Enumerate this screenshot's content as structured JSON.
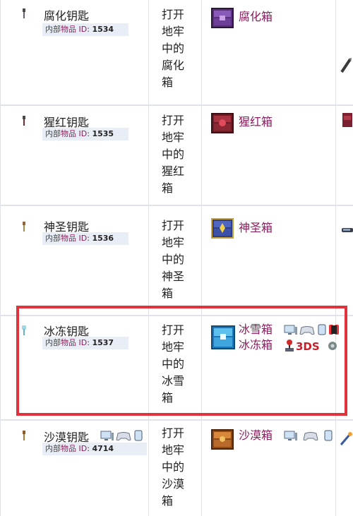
{
  "rows": [
    {
      "key_name": "腐化钥匙",
      "id_prefix": "内部",
      "id_item": "物品",
      "id_suffix": " ID",
      "id_colon": ":",
      "id_value": "1534",
      "description": "打开地牢中的腐化箱",
      "chest": "腐化箱",
      "chest_color": "#7a4aa0"
    },
    {
      "key_name": "猩红钥匙",
      "id_prefix": "内部",
      "id_item": "物品",
      "id_suffix": " ID",
      "id_colon": ":",
      "id_value": "1535",
      "description": "打开地牢中的猩红箱",
      "chest": "猩红箱",
      "chest_color": "#9a2a36"
    },
    {
      "key_name": "神圣钥匙",
      "id_prefix": "内部",
      "id_item": "物品",
      "id_suffix": " ID",
      "id_colon": ":",
      "id_value": "1536",
      "description": "打开地牢中的神圣箱",
      "chest": "神圣箱",
      "chest_color": "#3a4f9a"
    },
    {
      "key_name": "冰冻钥匙",
      "id_prefix": "内部",
      "id_item": "物品",
      "id_suffix": " ID",
      "id_colon": ":",
      "id_value": "1537",
      "description": "打开地牢中的冰雪箱",
      "chest": "冰雪箱",
      "chest_alt": "冰冻箱",
      "chest_color": "#3aa0d8",
      "platform_3ds": "3DS"
    },
    {
      "key_name": "沙漠钥匙",
      "id_prefix": "内部",
      "id_item": "物品",
      "id_suffix": " ID",
      "id_colon": ":",
      "id_value": "4714",
      "description": "打开地牢中的沙漠箱",
      "chest": "沙漠箱",
      "chest_color": "#c4762a"
    }
  ],
  "colors": {
    "highlight": "#e0333b",
    "accent_text": "#8b1e5c",
    "id_bg": "#e9eef6"
  }
}
